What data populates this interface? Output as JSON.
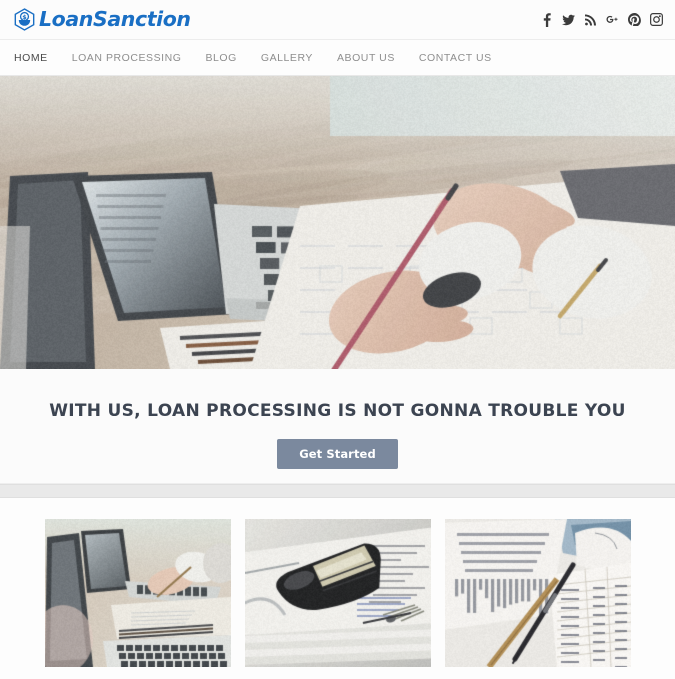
{
  "site": {
    "brand_name": "LoanSanction",
    "brand_icon": "dollar-shield-icon",
    "accent_color": "#1a6fc4"
  },
  "topbar": {
    "social_links": [
      {
        "name": "facebook-icon",
        "label": "f"
      },
      {
        "name": "twitter-icon",
        "label": "Twitter"
      },
      {
        "name": "rss-icon",
        "label": "RSS"
      },
      {
        "name": "google-plus-icon",
        "label": "G+"
      },
      {
        "name": "pinterest-icon",
        "label": "Pinterest"
      },
      {
        "name": "instagram-icon",
        "label": "Instagram"
      }
    ]
  },
  "nav": {
    "items": [
      {
        "label": "HOME",
        "active": true
      },
      {
        "label": "LOAN PROCESSING",
        "active": false
      },
      {
        "label": "BLOG",
        "active": false
      },
      {
        "label": "GALLERY",
        "active": false
      },
      {
        "label": "ABOUT US",
        "active": false
      },
      {
        "label": "CONTACT US",
        "active": false
      }
    ]
  },
  "hero": {
    "alt": "Person writing with a pencil on documents next to an open laptop on a wooden desk"
  },
  "cta": {
    "title": "WITH US, LOAN PROCESSING IS NOT GONNA TROUBLE YOU",
    "button_label": "Get Started",
    "button_color": "#7b899e"
  },
  "gallery": {
    "items": [
      {
        "alt": "Two people working at laptops with notebook and pencils on a desk"
      },
      {
        "alt": "Black stapler resting on a stack of printed documents"
      },
      {
        "alt": "Pen and pencil lying across printed forms and receipts"
      }
    ]
  }
}
